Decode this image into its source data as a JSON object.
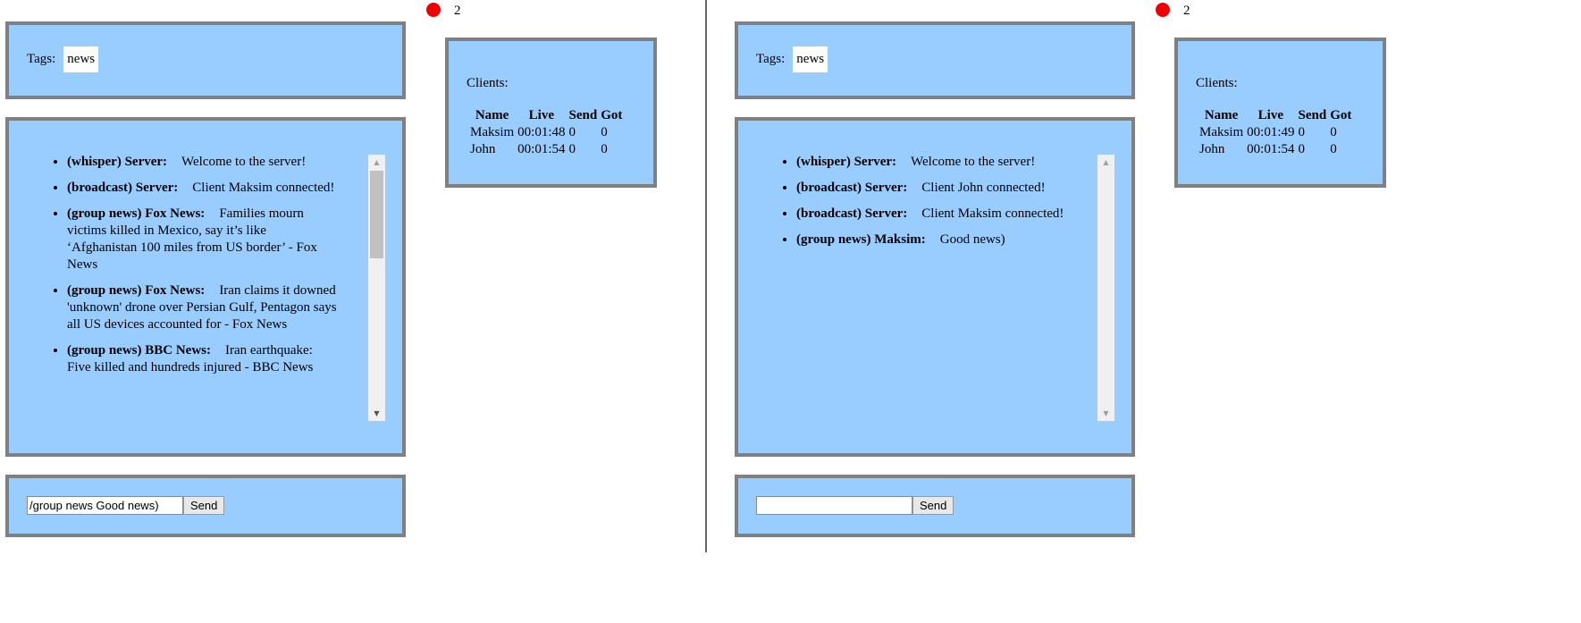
{
  "left": {
    "tags_label": "Tags:",
    "tag": "news",
    "status_count": "2",
    "clients_title": "Clients:",
    "client_headers": [
      "Name",
      "Live",
      "Send",
      "Got"
    ],
    "clients": [
      [
        "Maksim",
        "00:01:48",
        "0",
        "0"
      ],
      [
        "John",
        "00:01:54",
        "0",
        "0"
      ]
    ],
    "messages": [
      {
        "who": "(whisper) Server:",
        "text": "Welcome to the server!"
      },
      {
        "who": "(broadcast) Server:",
        "text": "Client Maksim connected!"
      },
      {
        "who": "(group news) Fox News:",
        "text": "Families mourn victims killed in Mexico, say it’s like ‘Afghanistan 100 miles from US border’ - Fox News"
      },
      {
        "who": "(group news) Fox News:",
        "text": "Iran claims it downed 'unknown' drone over Persian Gulf, Pentagon says all US devices accounted for - Fox News"
      },
      {
        "who": "(group news) BBC News:",
        "text": "Iran earthquake: Five killed and hundreds injured - BBC News"
      }
    ],
    "input_value": "/group news Good news)",
    "send_label": "Send"
  },
  "right": {
    "tags_label": "Tags:",
    "tag": "news",
    "status_count": "2",
    "clients_title": "Clients:",
    "client_headers": [
      "Name",
      "Live",
      "Send",
      "Got"
    ],
    "clients": [
      [
        "Maksim",
        "00:01:49",
        "0",
        "0"
      ],
      [
        "John",
        "00:01:54",
        "0",
        "0"
      ]
    ],
    "messages": [
      {
        "who": "(whisper) Server:",
        "text": "Welcome to the server!"
      },
      {
        "who": "(broadcast) Server:",
        "text": "Client John connected!"
      },
      {
        "who": "(broadcast) Server:",
        "text": "Client Maksim connected!"
      },
      {
        "who": "(group news) Maksim:",
        "text": "Good news)"
      }
    ],
    "input_value": "",
    "send_label": "Send"
  },
  "colors": {
    "panel_bg": "#99ccff",
    "panel_border": "#808080",
    "status_dot": "#ee0000"
  }
}
